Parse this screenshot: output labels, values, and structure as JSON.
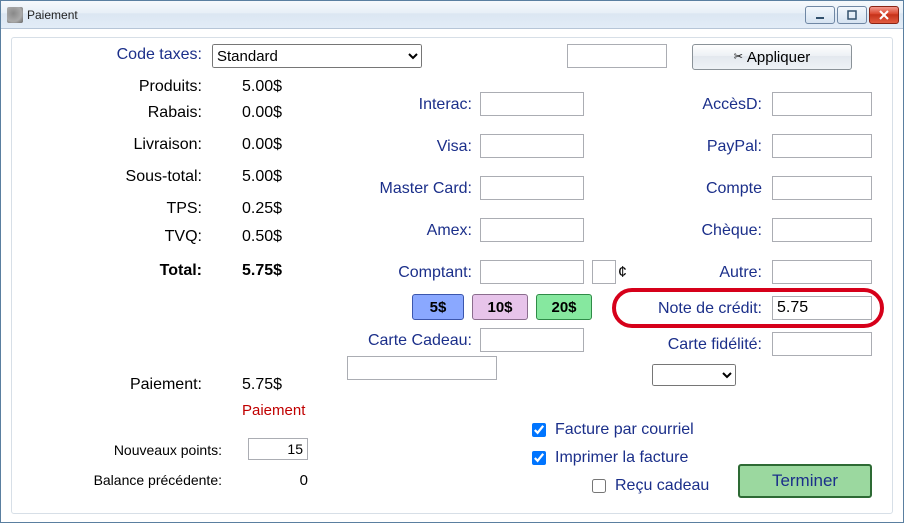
{
  "window": {
    "title": "Paiement"
  },
  "taxcode": {
    "label": "Code taxes:",
    "value": "Standard"
  },
  "summary": {
    "products_label": "Produits:",
    "products": "5.00$",
    "rebate_label": "Rabais:",
    "rebate": "0.00$",
    "shipping_label": "Livraison:",
    "shipping": "0.00$",
    "subtotal_label": "Sous-total:",
    "subtotal": "5.00$",
    "tps_label": "TPS:",
    "tps": "0.25$",
    "tvq_label": "TVQ:",
    "tvq": "0.50$",
    "total_label": "Total:",
    "total": "5.75$",
    "payment_label": "Paiement:",
    "payment": "5.75$",
    "status": "Paiement",
    "new_points_label": "Nouveaux points:",
    "new_points": "15",
    "prev_balance_label": "Balance précédente:",
    "prev_balance": "0"
  },
  "apply_button": "Appliquer",
  "methods": {
    "interac": "Interac:",
    "visa": "Visa:",
    "mastercard": "Master Card:",
    "amex": "Amex:",
    "comptant": "Comptant:",
    "cents": "¢",
    "giftcard": "Carte Cadeau:",
    "accesd": "AccèsD:",
    "paypal": "PayPal:",
    "compte": "Compte",
    "cheque": "Chèque:",
    "autre": "Autre:",
    "credit_note": "Note de crédit:",
    "credit_note_value": "5.75",
    "loyalty": "Carte fidélité:"
  },
  "quick": {
    "five": "5$",
    "ten": "10$",
    "twenty": "20$"
  },
  "options": {
    "email_invoice": "Facture par courriel",
    "print_invoice": "Imprimer la facture",
    "gift_receipt": "Reçu cadeau"
  },
  "finish_button": "Terminer"
}
